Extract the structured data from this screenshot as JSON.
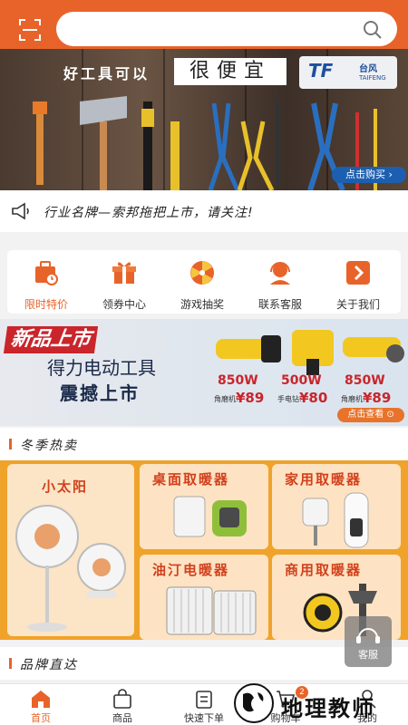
{
  "colors": {
    "accent": "#e8632a",
    "brand_blue": "#1c5fb0",
    "promo_red": "#c9252b",
    "hot_bg": "#f0a32a"
  },
  "header": {
    "scan_icon": "scan-icon",
    "search_placeholder": "",
    "search_icon": "search-icon"
  },
  "banner": {
    "title": "好工具可以",
    "title_highlight": "很便宜",
    "logo_tf": "TF",
    "logo_cn": "台风",
    "logo_en": "TAIFENG",
    "buy_button": "点击购买 ›"
  },
  "notice": {
    "icon": "megaphone-icon",
    "text": "行业名牌—索邦拖把上市，请关注!"
  },
  "menu": [
    {
      "label": "限时特价",
      "icon": "flash-sale-icon",
      "active": true
    },
    {
      "label": "领券中心",
      "icon": "gift-icon",
      "active": false
    },
    {
      "label": "游戏抽奖",
      "icon": "lottery-wheel-icon",
      "active": false
    },
    {
      "label": "联系客服",
      "icon": "customer-service-icon",
      "active": false
    },
    {
      "label": "关于我们",
      "icon": "about-arrow-icon",
      "active": false
    }
  ],
  "promo": {
    "tag": "新品上市",
    "line1": "得力电动工具",
    "line2": "震撼上市",
    "prices": [
      {
        "watt": "850W",
        "kind": "角磨机:",
        "price": "¥89"
      },
      {
        "watt": "500W",
        "kind": "手电钻:",
        "price": "¥80"
      },
      {
        "watt": "850W",
        "kind": "角磨机:",
        "price": "¥89"
      }
    ],
    "button": "点击查看 ⊙"
  },
  "section_winter": {
    "title": "冬季热卖"
  },
  "hot": {
    "big": {
      "label": "小太阳"
    },
    "tiles": [
      {
        "label": "桌面取暖器"
      },
      {
        "label": "家用取暖器"
      },
      {
        "label": "油汀电暖器"
      },
      {
        "label": "商用取暖器"
      }
    ]
  },
  "section_brand": {
    "title": "品牌直达"
  },
  "cs_float": {
    "label": "客服"
  },
  "tabbar": [
    {
      "label": "首页",
      "icon": "home-icon",
      "active": true
    },
    {
      "label": "商品",
      "icon": "shopping-bag-icon",
      "active": false
    },
    {
      "label": "快速下单",
      "icon": "quick-order-icon",
      "active": false
    },
    {
      "label": "购物车",
      "icon": "cart-icon",
      "active": false,
      "badge": "2"
    },
    {
      "label": "我的",
      "icon": "user-icon",
      "active": false
    }
  ],
  "watermark": {
    "text": "地理教师"
  }
}
